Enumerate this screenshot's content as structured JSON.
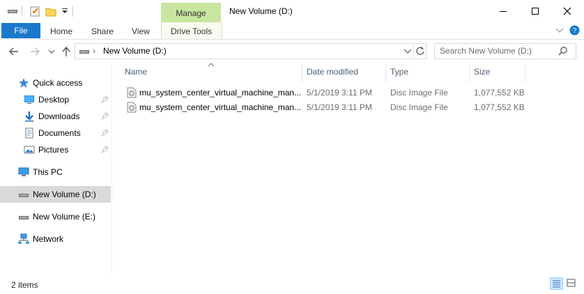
{
  "window": {
    "title": "New Volume (D:)",
    "context_tab_group": "Manage",
    "controls": [
      "minimize",
      "maximize",
      "close"
    ]
  },
  "quick_access_toolbar": {
    "icons": [
      "drive-icon",
      "properties-check-icon",
      "new-folder-icon",
      "customize-dropdown-icon"
    ]
  },
  "ribbon": {
    "tabs": [
      {
        "label": "File"
      },
      {
        "label": "Home"
      },
      {
        "label": "Share"
      },
      {
        "label": "View"
      },
      {
        "label": "Drive Tools"
      }
    ]
  },
  "address": {
    "path_segment": "New Volume (D:)",
    "search_placeholder": "Search New Volume (D:)"
  },
  "nav": {
    "items": [
      {
        "label": "Quick access",
        "icon": "star-icon"
      },
      {
        "label": "Desktop",
        "icon": "desktop-icon",
        "pinned": true
      },
      {
        "label": "Downloads",
        "icon": "download-icon",
        "pinned": true
      },
      {
        "label": "Documents",
        "icon": "documents-icon",
        "pinned": true
      },
      {
        "label": "Pictures",
        "icon": "pictures-icon",
        "pinned": true
      },
      {
        "label": "This PC",
        "icon": "computer-icon"
      },
      {
        "label": "New Volume (D:)",
        "icon": "drive-icon",
        "selected": true
      },
      {
        "label": "New Volume (E:)",
        "icon": "drive-icon"
      },
      {
        "label": "Network",
        "icon": "network-icon"
      }
    ]
  },
  "columns": {
    "name": "Name",
    "date": "Date modified",
    "type": "Type",
    "size": "Size"
  },
  "files": [
    {
      "name": "mu_system_center_virtual_machine_man...",
      "date": "5/1/2019 3:11 PM",
      "type": "Disc Image File",
      "size": "1,077,552 KB"
    },
    {
      "name": "mu_system_center_virtual_machine_man...",
      "date": "5/1/2019 3:11 PM",
      "type": "Disc Image File",
      "size": "1,077,552 KB"
    }
  ],
  "status": {
    "item_count": "2 items"
  },
  "colors": {
    "accent": "#1979ca",
    "manage_tab": "#c8e6a0",
    "selection": "#d9d9d9"
  }
}
